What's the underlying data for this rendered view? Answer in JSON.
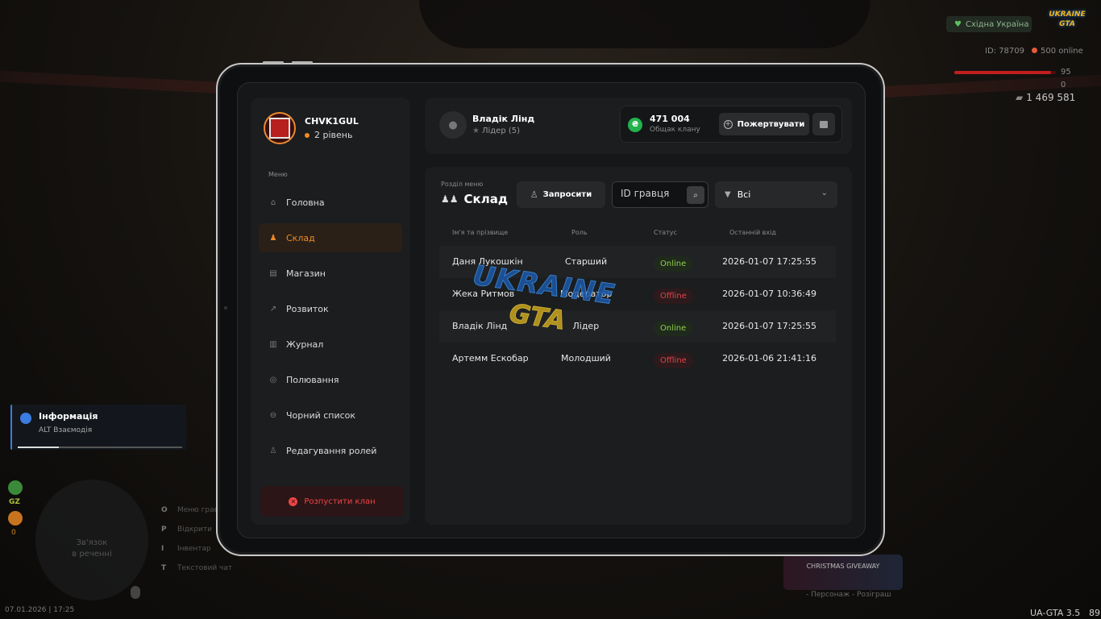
{
  "hud": {
    "server": "Східна Україна",
    "logo": "UKRAINE GTA",
    "player_id": "ID: 78709",
    "online": "500 online",
    "hp": "95",
    "hp_fraction": 0.95,
    "armor": "0",
    "money": "1 469 581"
  },
  "toast": {
    "title": "Інформація",
    "text": "ALT Взаємодія",
    "progress": 0.25
  },
  "bottom_left": {
    "gz_label": "GZ",
    "zero": "0",
    "minimap_text_1": "Зв'язок",
    "minimap_text_2": "в реченні",
    "keys": [
      {
        "key": "O",
        "label": "Меню гравця"
      },
      {
        "key": "P",
        "label": "Відкрити"
      },
      {
        "key": "I",
        "label": "Інвентар"
      },
      {
        "key": "T",
        "label": "Текстовий чат"
      }
    ],
    "datetime": "07.01.2026 | 17:25"
  },
  "bottom_right": {
    "event_label": "CHRISTMAS GIVEAWAY",
    "event_caption": "- Персонаж - Розіграш",
    "version": "UA-GTA 3.5",
    "fps": "89"
  },
  "clan": {
    "name": "CHVK1GUL",
    "level": "2 рівень"
  },
  "menu": {
    "caption": "Меню",
    "items": [
      {
        "label": "Головна",
        "icon": "home-icon",
        "glyph": "⌂"
      },
      {
        "label": "Склад",
        "icon": "group-icon",
        "glyph": "♟"
      },
      {
        "label": "Магазин",
        "icon": "basket-icon",
        "glyph": "▤"
      },
      {
        "label": "Розвиток",
        "icon": "chart-icon",
        "glyph": "↗"
      },
      {
        "label": "Журнал",
        "icon": "book-icon",
        "glyph": "▥"
      },
      {
        "label": "Полювання",
        "icon": "target-icon",
        "glyph": "◎"
      },
      {
        "label": "Чорний список",
        "icon": "blacklist-icon",
        "glyph": "⊖"
      },
      {
        "label": "Редагування ролей",
        "icon": "user-edit-icon",
        "glyph": "♙"
      }
    ],
    "active_index": 1,
    "disband_label": "Розпустити клан"
  },
  "user": {
    "name": "Владік Лінд",
    "role": "Лідер (5)"
  },
  "bank": {
    "amount": "471 004",
    "label": "Общак клану",
    "donate_label": "Пожертвувати",
    "currency_glyph": "₴"
  },
  "section": {
    "caption": "Розділ меню",
    "title": "Склад",
    "invite_label": "Запросити",
    "search_placeholder": "ID гравця",
    "filter_value": "Всі"
  },
  "table": {
    "columns": [
      "Ім'я та прізвище",
      "Роль",
      "Статус",
      "Останній вхід"
    ],
    "rows": [
      {
        "name": "Даня Лукошкін",
        "role": "Старший",
        "status": "Online",
        "online": true,
        "last": "2026-01-07 17:25:55"
      },
      {
        "name": "Жека Ритмов",
        "role": "Модератор",
        "status": "Offline",
        "online": false,
        "last": "2026-01-07 10:36:49"
      },
      {
        "name": "Владік Лінд",
        "role": "Лідер",
        "status": "Online",
        "online": true,
        "last": "2026-01-07 17:25:55"
      },
      {
        "name": "Артемм Ескобар",
        "role": "Молодший",
        "status": "Offline",
        "online": false,
        "last": "2026-01-06 21:41:16"
      }
    ]
  },
  "watermark": {
    "line1": "UKRAINE",
    "line2": "GTA"
  }
}
